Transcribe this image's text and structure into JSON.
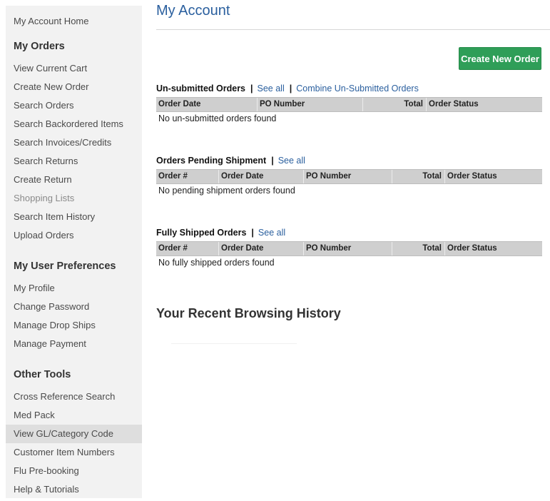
{
  "sidebar": {
    "home": "My Account Home",
    "orders": {
      "heading": "My Orders",
      "items": [
        "View Current Cart",
        "Create New Order",
        "Search Orders",
        "Search Backordered Items",
        "Search Invoices/Credits",
        "Search Returns",
        "Create Return",
        "Shopping Lists",
        "Search Item History",
        "Upload Orders"
      ]
    },
    "prefs": {
      "heading": "My User Preferences",
      "items": [
        "My Profile",
        "Change Password",
        "Manage Drop Ships",
        "Manage Payment"
      ]
    },
    "tools": {
      "heading": "Other Tools",
      "items": [
        "Cross Reference Search",
        "Med Pack",
        "View GL/Category Code",
        "Customer Item Numbers",
        "Flu Pre-booking",
        "Help & Tutorials"
      ]
    }
  },
  "main": {
    "title": "My Account",
    "create_button": "Create New Order",
    "sections": [
      {
        "title": "Un-submitted Orders",
        "links": [
          "See all",
          "Combine Un-Submitted Orders"
        ],
        "columns": [
          "Order Date",
          "PO Number",
          "Total",
          "Order Status"
        ],
        "empty": "No un-submitted orders found"
      },
      {
        "title": "Orders Pending Shipment",
        "links": [
          "See all"
        ],
        "columns": [
          "Order #",
          "Order Date",
          "PO Number",
          "Total",
          "Order Status"
        ],
        "empty": "No pending shipment orders found"
      },
      {
        "title": "Fully Shipped Orders",
        "links": [
          "See all"
        ],
        "columns": [
          "Order #",
          "Order Date",
          "PO Number",
          "Total",
          "Order Status"
        ],
        "empty": "No fully shipped orders found"
      }
    ],
    "recent_history_title": "Your Recent Browsing History"
  }
}
